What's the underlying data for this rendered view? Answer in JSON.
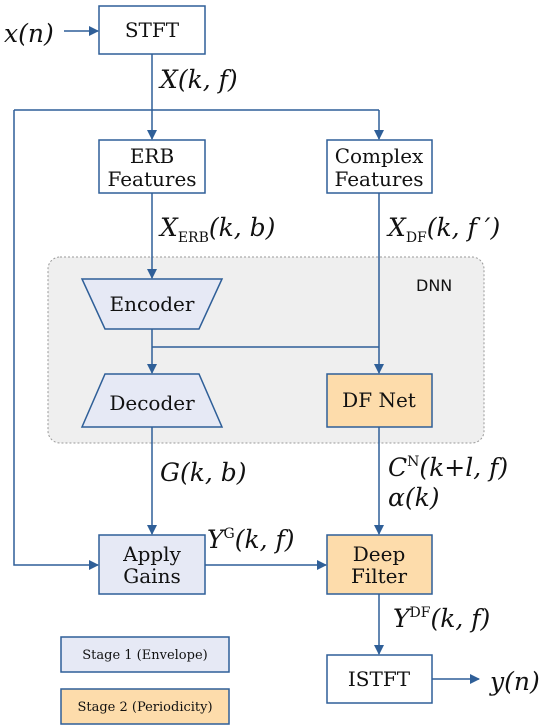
{
  "colors": {
    "stroke": "#2f5f98",
    "stage1": "#e6e9f5",
    "stage2": "#fddcab",
    "dnn_bg": "#efefef"
  },
  "blocks": {
    "stft": "STFT",
    "erb_line1": "ERB",
    "erb_line2": "Features",
    "complex_line1": "Complex",
    "complex_line2": "Features",
    "dnn": "DNN",
    "encoder": "Encoder",
    "decoder": "Decoder",
    "df_net": "DF Net",
    "apply_line1": "Apply",
    "apply_line2": "Gains",
    "deep_line1": "Deep",
    "deep_line2": "Filter",
    "istft": "ISTFT"
  },
  "signals": {
    "input": {
      "base": "x",
      "args": "(n)"
    },
    "spectrum": {
      "base": "X",
      "args": "(k, f)"
    },
    "x_erb": {
      "base": "X",
      "sub": "ERB",
      "args": "(k, b)"
    },
    "x_df": {
      "base": "X",
      "sub": "DF",
      "args": "(k, f ′)"
    },
    "gains": {
      "base": "G",
      "args": "(k, b)"
    },
    "coefs": {
      "base": "C",
      "sup": "N",
      "args": "(k+l, f)"
    },
    "alpha": {
      "base": "α",
      "args": "(k)"
    },
    "y_g": {
      "base": "Y",
      "sup": "G",
      "args": "(k, f)"
    },
    "y_df": {
      "base": "Y",
      "sup": "DF",
      "args": "(k, f)"
    },
    "output": {
      "base": "y",
      "args": "(n)"
    }
  },
  "legend": {
    "stage1": "Stage 1 (Envelope)",
    "stage2": "Stage 2 (Periodicity)"
  }
}
